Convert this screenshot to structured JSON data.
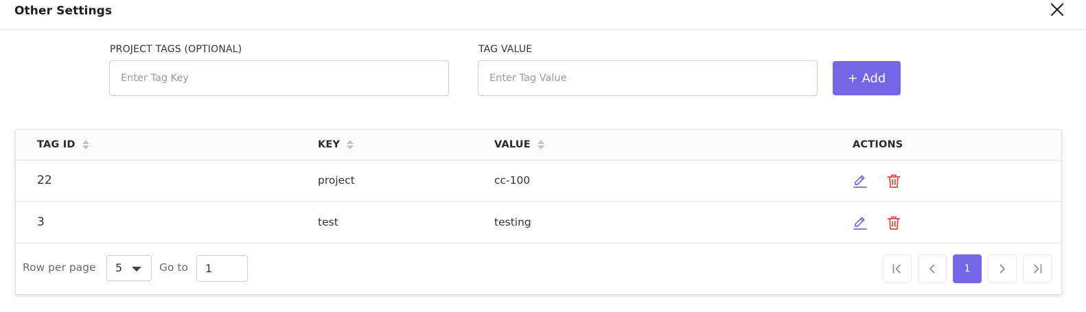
{
  "header": {
    "title": "Other Settings",
    "close_icon": "close-icon"
  },
  "form": {
    "tag_key_label": "PROJECT TAGS (OPTIONAL)",
    "tag_key_placeholder": "Enter Tag Key",
    "tag_key_value": "",
    "tag_value_label": "TAG VALUE",
    "tag_value_placeholder": "Enter Tag Value",
    "tag_value_value": "",
    "add_label": "+ Add"
  },
  "table": {
    "columns": {
      "tag_id": "TAG ID",
      "key": "KEY",
      "value": "VALUE",
      "actions": "ACTIONS"
    },
    "rows": [
      {
        "tag_id": "22",
        "key": "project",
        "value": "cc-100"
      },
      {
        "tag_id": "3",
        "key": "test",
        "value": "testing"
      }
    ],
    "row_icons": [
      "edit-icon",
      "delete-icon"
    ]
  },
  "footer": {
    "rows_per_page_label": "Row per page",
    "rows_per_page_value": "5",
    "goto_label": "Go to",
    "goto_value": "1",
    "current_page": "1"
  },
  "colors": {
    "accent": "#7367e8",
    "danger": "#e5453b",
    "border": "#cfcfcf"
  }
}
